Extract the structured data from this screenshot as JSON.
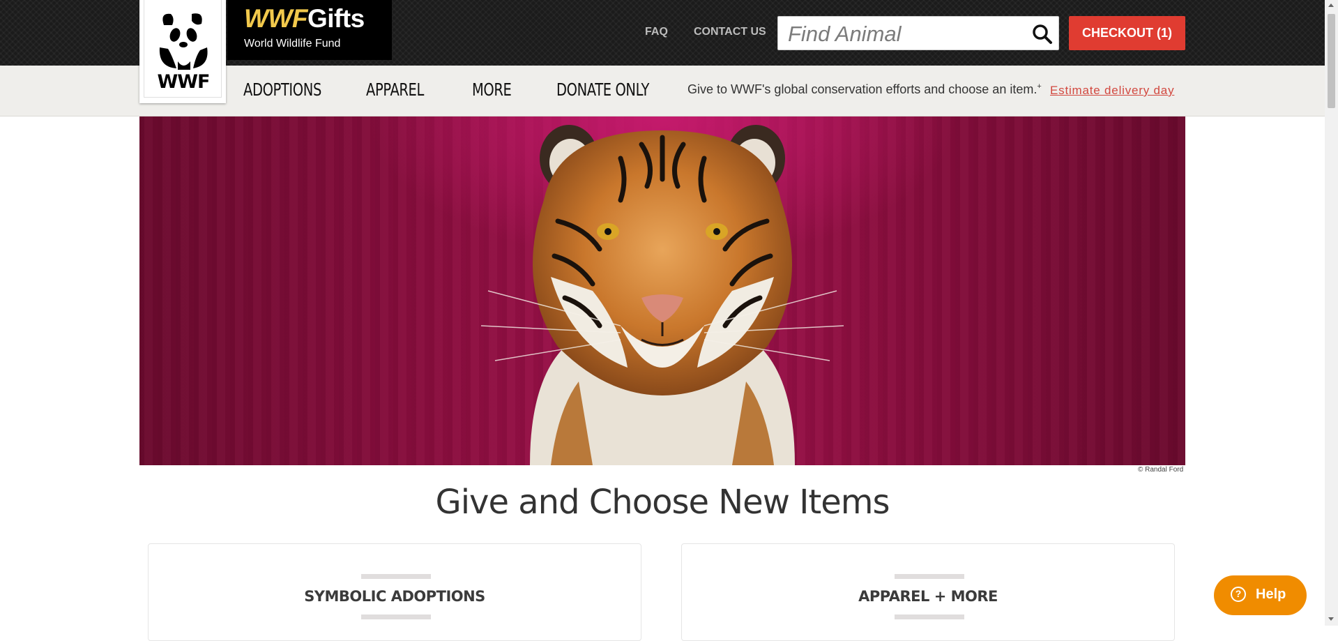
{
  "brand": {
    "logo_text": "WWF",
    "title_wwf": "WWF",
    "title_gifts": "Gifts",
    "subtitle": "World Wildlife Fund"
  },
  "header": {
    "faq": "FAQ",
    "contact": "CONTACT US",
    "search_placeholder": "Find Animal",
    "search_icon": "search-icon",
    "checkout": "CHECKOUT (1)"
  },
  "nav": {
    "items": [
      "ADOPTIONS",
      "APPAREL",
      "MORE",
      "DONATE ONLY"
    ],
    "promo": "Give to WWF's global conservation efforts and choose an item.",
    "promo_mark": "+",
    "estimate": "Estimate delivery day"
  },
  "hero": {
    "subject": "tiger-portrait",
    "credit": "© Randal Ford"
  },
  "main": {
    "section_title": "Give and Choose New Items",
    "cards": [
      {
        "title": "SYMBOLIC ADOPTIONS"
      },
      {
        "title": "APPAREL + MORE"
      }
    ]
  },
  "help": {
    "label": "Help",
    "icon": "question-icon"
  },
  "colors": {
    "topbar": "#1b1b1b",
    "brand_yellow": "#f2c94c",
    "checkout_red": "#e03c31",
    "hero_magenta": "#8c0e3f",
    "help_orange": "#f08c00",
    "link_red": "#d2483f"
  }
}
